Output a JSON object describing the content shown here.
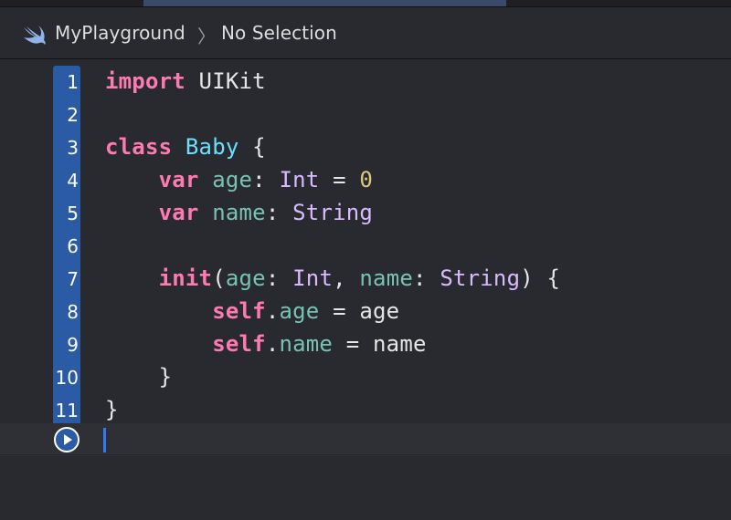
{
  "breadcrumb": {
    "project": "MyPlayground",
    "separator": "〉",
    "selection": "No Selection"
  },
  "icons": {
    "project": "swift-icon",
    "run": "play-circle-icon"
  },
  "editor": {
    "line_numbers": [
      "1",
      "2",
      "3",
      "4",
      "5",
      "6",
      "7",
      "8",
      "9",
      "10",
      "11"
    ],
    "lines": [
      [
        {
          "t": "import",
          "c": "kw"
        },
        {
          "t": " UIKit",
          "c": "pl"
        }
      ],
      [],
      [
        {
          "t": "class",
          "c": "kw"
        },
        {
          "t": " ",
          "c": "pl"
        },
        {
          "t": "Baby",
          "c": "pr"
        },
        {
          "t": " {",
          "c": "pl"
        }
      ],
      [
        {
          "t": "    ",
          "c": "pl"
        },
        {
          "t": "var",
          "c": "kw"
        },
        {
          "t": " ",
          "c": "pl"
        },
        {
          "t": "age",
          "c": "pa"
        },
        {
          "t": ": ",
          "c": "pl"
        },
        {
          "t": "Int",
          "c": "ty"
        },
        {
          "t": " = ",
          "c": "pl"
        },
        {
          "t": "0",
          "c": "nm"
        }
      ],
      [
        {
          "t": "    ",
          "c": "pl"
        },
        {
          "t": "var",
          "c": "kw"
        },
        {
          "t": " ",
          "c": "pl"
        },
        {
          "t": "name",
          "c": "pa"
        },
        {
          "t": ": ",
          "c": "pl"
        },
        {
          "t": "String",
          "c": "ty"
        }
      ],
      [],
      [
        {
          "t": "    ",
          "c": "pl"
        },
        {
          "t": "init",
          "c": "kw"
        },
        {
          "t": "(",
          "c": "pl"
        },
        {
          "t": "age",
          "c": "pa"
        },
        {
          "t": ": ",
          "c": "pl"
        },
        {
          "t": "Int",
          "c": "ty"
        },
        {
          "t": ", ",
          "c": "pl"
        },
        {
          "t": "name",
          "c": "pa"
        },
        {
          "t": ": ",
          "c": "pl"
        },
        {
          "t": "String",
          "c": "ty"
        },
        {
          "t": ") {",
          "c": "pl"
        }
      ],
      [
        {
          "t": "        ",
          "c": "pl"
        },
        {
          "t": "self",
          "c": "kw"
        },
        {
          "t": ".",
          "c": "pl"
        },
        {
          "t": "age",
          "c": "pa"
        },
        {
          "t": " = age",
          "c": "pl"
        }
      ],
      [
        {
          "t": "        ",
          "c": "pl"
        },
        {
          "t": "self",
          "c": "kw"
        },
        {
          "t": ".",
          "c": "pl"
        },
        {
          "t": "name",
          "c": "pa"
        },
        {
          "t": " = name",
          "c": "pl"
        }
      ],
      [
        {
          "t": "    }",
          "c": "pl"
        }
      ],
      [
        {
          "t": "}",
          "c": "pl"
        }
      ]
    ]
  },
  "colors": {
    "keyword": "#ff7ab2",
    "type": "#dabaff",
    "project_type": "#6bdfff",
    "property": "#78c2b3",
    "number": "#d9c97c",
    "gutter_selection": "#2b5ba5",
    "cursor": "#3478f6"
  }
}
